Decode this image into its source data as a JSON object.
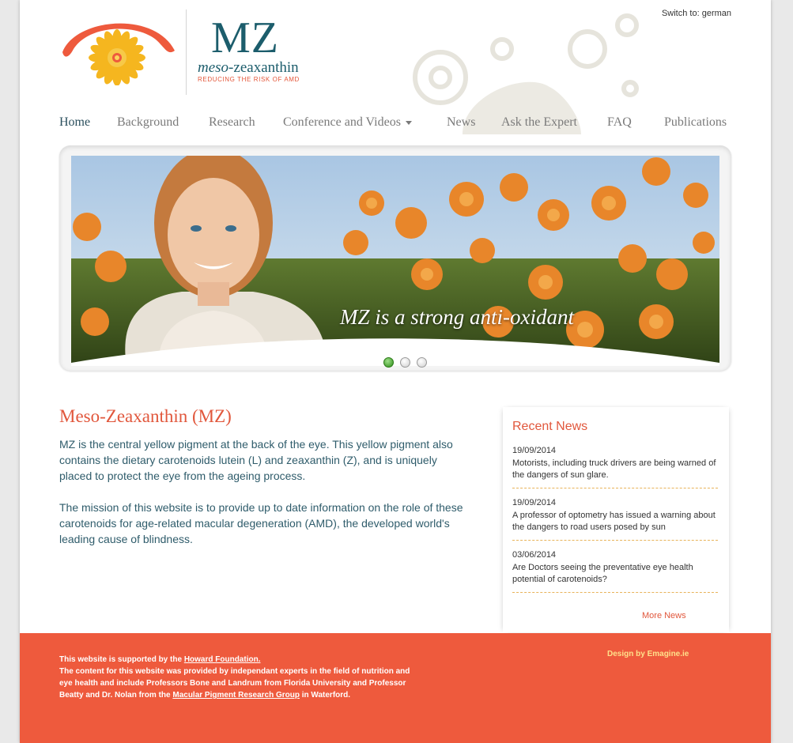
{
  "header": {
    "logo_mark": "MZ",
    "logo_name_prefix": "meso-",
    "logo_name_suffix": "zeaxanthin",
    "logo_tagline": "REDUCING THE RISK OF AMD",
    "switch_label": "Switch to:",
    "switch_language": "german"
  },
  "nav": {
    "items": [
      {
        "label": "Home"
      },
      {
        "label": "Background"
      },
      {
        "label": "Research"
      },
      {
        "label": "Conference and Videos"
      },
      {
        "label": "News"
      },
      {
        "label": "Ask the Expert"
      },
      {
        "label": "FAQ"
      },
      {
        "label": "Publications"
      }
    ]
  },
  "slider": {
    "caption": "MZ is a strong anti-oxidant",
    "slide_count": 3,
    "active_slide": 1
  },
  "main": {
    "title": "Meso-Zeaxanthin (MZ)",
    "paragraph1": "MZ is the central yellow pigment at the back of the eye. This yellow pigment also contains the dietary carotenoids lutein (L) and zeaxanthin (Z), and is uniquely placed to protect the eye from the ageing process.",
    "paragraph2": "The mission of this website is to provide up to date information on the role of these carotenoids for age-related macular degeneration (AMD), the developed world's leading cause of blindness."
  },
  "news": {
    "title": "Recent News",
    "items": [
      {
        "date": "19/09/2014",
        "text": "Motorists, including truck drivers are being warned of the dangers of sun glare."
      },
      {
        "date": "19/09/2014",
        "text": "A professor of optometry has issued a warning about the dangers to road users posed by sun"
      },
      {
        "date": "03/06/2014",
        "text": "Are Doctors seeing the preventative eye health potential of carotenoids?"
      }
    ],
    "more_label": "More News"
  },
  "footer": {
    "supported_prefix": "This website is supported by the",
    "howard_link": "Howard Foundation.",
    "content_text": "The content for this website was provided by independant experts in the field of nutrition and eye health and include Professors Bone and Landrum from Florida University and Professor Beatty and Dr. Nolan from the",
    "macular_link": "Macular Pigment Research Group",
    "content_suffix": "in Waterford.",
    "design_credit": "Design by Emagine.ie"
  },
  "colors": {
    "accent": "#e1573c",
    "brand_teal": "#1c5d6c",
    "footer_bg": "#ee5a3d",
    "dot_active": "#2c8b16"
  },
  "icons": {
    "logo_icon": "eye-sunflower-logo-icon",
    "caret_icon": "caret-down-icon"
  }
}
